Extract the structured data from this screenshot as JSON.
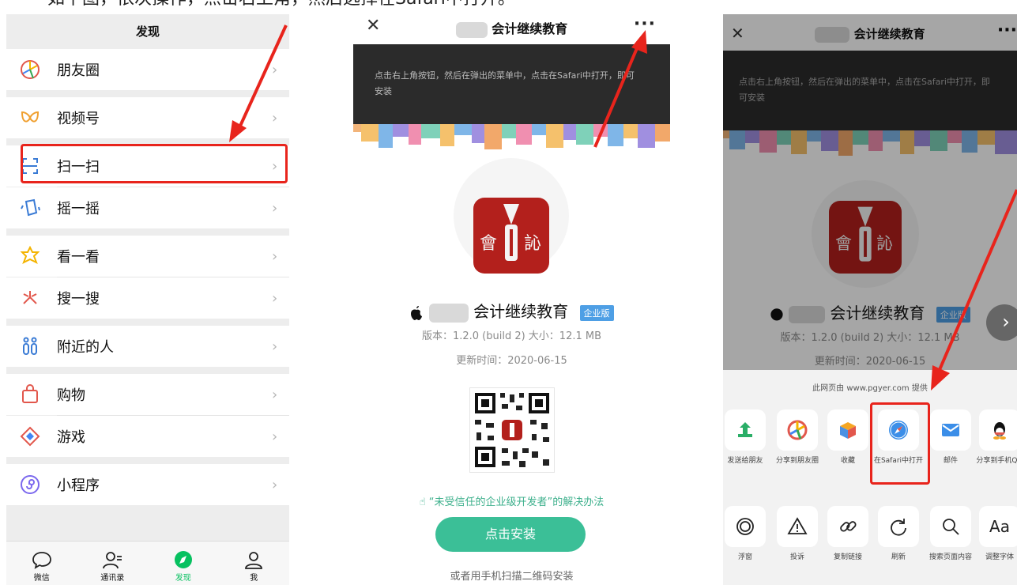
{
  "caption": "如下图，依次操作，点击右上角，然后选择在Safari中打开。",
  "panel1": {
    "title": "发现",
    "items": [
      {
        "label": "朋友圈",
        "icon": "moments-icon"
      },
      {
        "label": "视频号",
        "icon": "channels-icon"
      },
      {
        "label": "扫一扫",
        "icon": "scan-icon"
      },
      {
        "label": "摇一摇",
        "icon": "shake-icon"
      },
      {
        "label": "看一看",
        "icon": "top-stories-icon"
      },
      {
        "label": "搜一搜",
        "icon": "search-icon"
      },
      {
        "label": "附近的人",
        "icon": "people-nearby-icon"
      },
      {
        "label": "购物",
        "icon": "shopping-icon"
      },
      {
        "label": "游戏",
        "icon": "games-icon"
      },
      {
        "label": "小程序",
        "icon": "mini-programs-icon"
      }
    ],
    "chevron": "›",
    "tabs": [
      {
        "label": "微信",
        "icon": "chat-icon"
      },
      {
        "label": "通讯录",
        "icon": "contacts-icon"
      },
      {
        "label": "发现",
        "icon": "discover-icon",
        "active": true
      },
      {
        "label": "我",
        "icon": "me-icon"
      }
    ]
  },
  "panel2": {
    "close": "✕",
    "title": "会计继续教育",
    "more": "···",
    "banner_text": "点击右上角按钮，然后在弹出的菜单中，点击在Safari中打开，即可安装",
    "logo_text_left": "會",
    "logo_text_right": "訫",
    "app_name": "会计继续教育",
    "badge": "企业版",
    "version": "版本：1.2.0 (build 2)   大小：12.1 MB",
    "updated": "更新时间：2020-06-15",
    "hint": "“未受信任的企业级开发者”的解决办法",
    "install": "点击安装",
    "footer": "或者用手机扫描二维码安装"
  },
  "panel3": {
    "close": "✕",
    "title": "会计继续教育",
    "more": "···",
    "banner_text": "点击右上角按钮，然后在弹出的菜单中，点击在Safari中打开，即可安装",
    "app_name": "会计继续教育",
    "badge": "企业版",
    "version": "版本：1.2.0 (build 2)   大小：12.1 MB",
    "updated": "更新时间：2020-06-15",
    "provider": "此网页由 www.pgyer.com 提供",
    "next": "›",
    "row1": [
      {
        "label": "发送给朋友",
        "icon": "send-to-friend-icon"
      },
      {
        "label": "分享到朋友圈",
        "icon": "share-moments-icon"
      },
      {
        "label": "收藏",
        "icon": "favorite-icon"
      },
      {
        "label": "在Safari中打开",
        "icon": "safari-icon"
      },
      {
        "label": "邮件",
        "icon": "mail-icon"
      },
      {
        "label": "分享到手机QQ",
        "icon": "qq-icon"
      }
    ],
    "row2": [
      {
        "label": "浮窗",
        "icon": "float-window-icon"
      },
      {
        "label": "投诉",
        "icon": "report-icon"
      },
      {
        "label": "复制链接",
        "icon": "copy-link-icon"
      },
      {
        "label": "刷新",
        "icon": "refresh-icon"
      },
      {
        "label": "搜索页面内容",
        "icon": "search-page-icon"
      },
      {
        "label": "调整字体",
        "icon": "font-size-icon",
        "glyph": "Aa"
      }
    ]
  },
  "colors": {
    "highlight": "#e8241c",
    "wechat_green": "#07c160",
    "install_green": "#3bbf97",
    "badge_blue": "#4e9fe5",
    "logo_red": "#b3201c"
  }
}
